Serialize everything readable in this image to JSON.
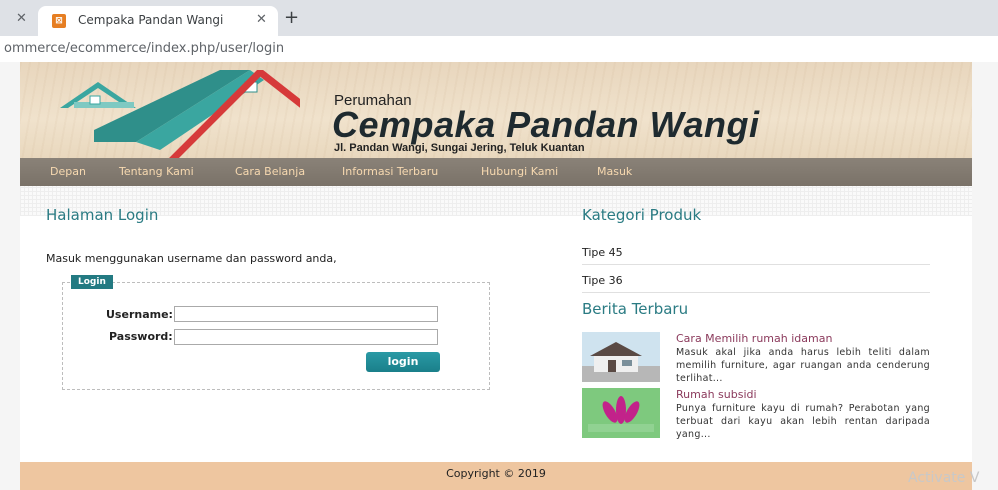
{
  "browser": {
    "tab_title": "Cempaka Pandan Wangi",
    "url": "ommerce/ecommerce/index.php/user/login"
  },
  "header": {
    "brand_small": "Perumahan",
    "brand_big": "Cempaka Pandan Wangi",
    "address": "Jl. Pandan Wangi, Sungai Jering, Teluk Kuantan"
  },
  "nav": {
    "items": [
      "Depan",
      "Tentang Kami",
      "Cara Belanja",
      "Informasi Terbaru",
      "Hubungi Kami",
      "Masuk"
    ]
  },
  "login": {
    "heading": "Halaman Login",
    "intro": "Masuk menggunakan username dan password anda,",
    "legend": "Login",
    "username_label": "Username:",
    "password_label": "Password:",
    "username_value": "",
    "password_value": "",
    "button": "login"
  },
  "sidebar": {
    "category_heading": "Kategori Produk",
    "categories": [
      "Tipe 45",
      "Tipe 36"
    ],
    "news_heading": "Berita Terbaru",
    "news": [
      {
        "title": "Cara Memilih rumah idaman",
        "desc": "Masuk akal jika anda harus lebih teliti dalam memilih furniture, agar ruangan anda cenderung terlihat..."
      },
      {
        "title": "Rumah subsidi",
        "desc": "Punya furniture kayu di rumah? Perabotan yang terbuat dari kayu akan lebih rentan daripada yang..."
      }
    ]
  },
  "footer": {
    "copyright": "Copyright © 2019"
  },
  "watermark": "Activate V",
  "colors": {
    "accent": "#2a7b83",
    "nav": "#7a7268",
    "footer": "#eec6a0",
    "news_title": "#8b3a5c"
  },
  "icons": [
    "close-icon",
    "favicon-icon",
    "new-tab-icon",
    "house-logo-icon"
  ]
}
